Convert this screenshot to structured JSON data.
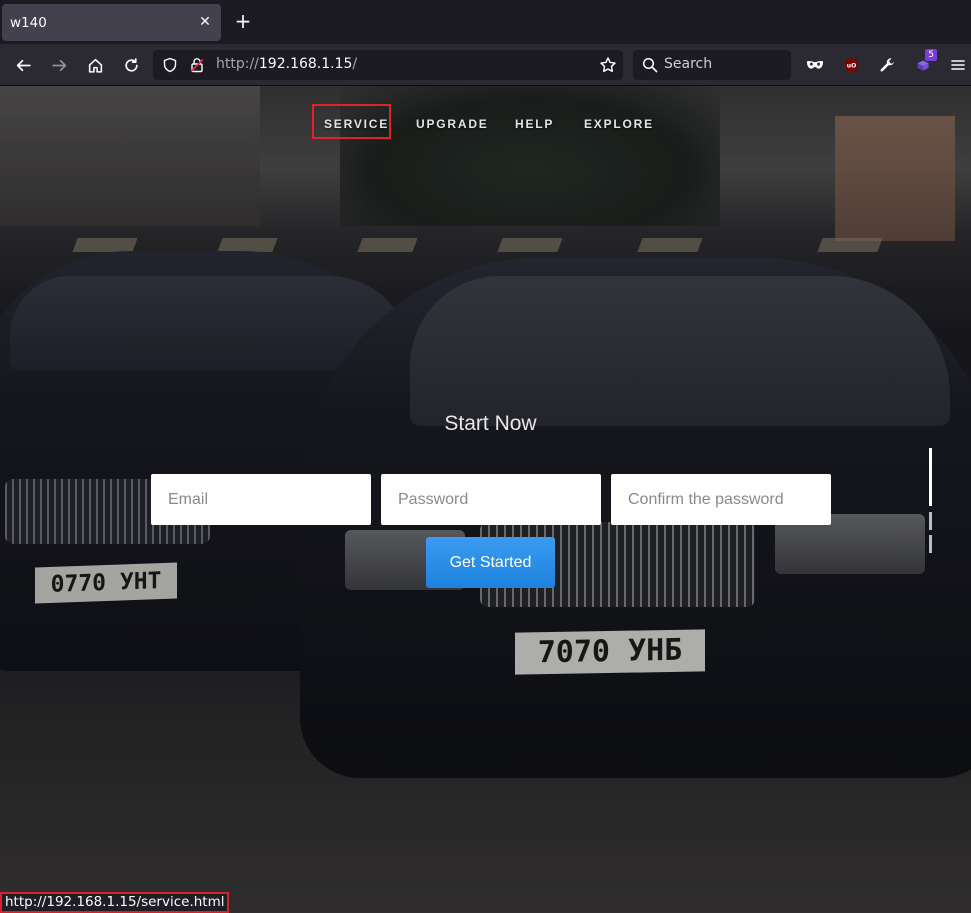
{
  "browser": {
    "tab": {
      "title": "w140",
      "close_icon": "close-icon"
    },
    "new_tab_icon": "plus-icon",
    "toolbar": {
      "back_icon": "back-arrow-icon",
      "forward_icon": "forward-arrow-icon",
      "home_icon": "home-icon",
      "reload_icon": "reload-icon"
    },
    "urlbar": {
      "scheme": "http://",
      "host": "192.168.1.15",
      "path": "/",
      "shield_icon": "tracking-shield-icon",
      "lock_icon": "insecure-lock-icon",
      "bookmark_icon": "star-icon"
    },
    "search": {
      "placeholder": "Search",
      "icon": "magnifier-icon"
    },
    "extensions": {
      "mask_icon": "mask-icon",
      "ublock_icon": "ublock-icon",
      "tools_icon": "wrench-icon",
      "puzzle_icon": "extensions-icon",
      "puzzle_badge": "5",
      "menu_icon": "hamburger-menu-icon"
    },
    "status_url": "http://192.168.1.15/service.html"
  },
  "page": {
    "nav": [
      "SERVICE",
      "UPGRADE",
      "HELP",
      "EXPLORE"
    ],
    "hero_title": "Start Now",
    "form": {
      "email_placeholder": "Email",
      "password_placeholder": "Password",
      "confirm_placeholder": "Confirm the password",
      "submit_label": "Get Started"
    },
    "background": {
      "plate_left": "0770 УНТ",
      "plate_right": "7070 УНБ"
    }
  },
  "colors": {
    "highlight": "#e0222b",
    "cta": "#1e82dd",
    "chrome_dark": "#1c1b22",
    "chrome_toolbar": "#2b2a33"
  }
}
